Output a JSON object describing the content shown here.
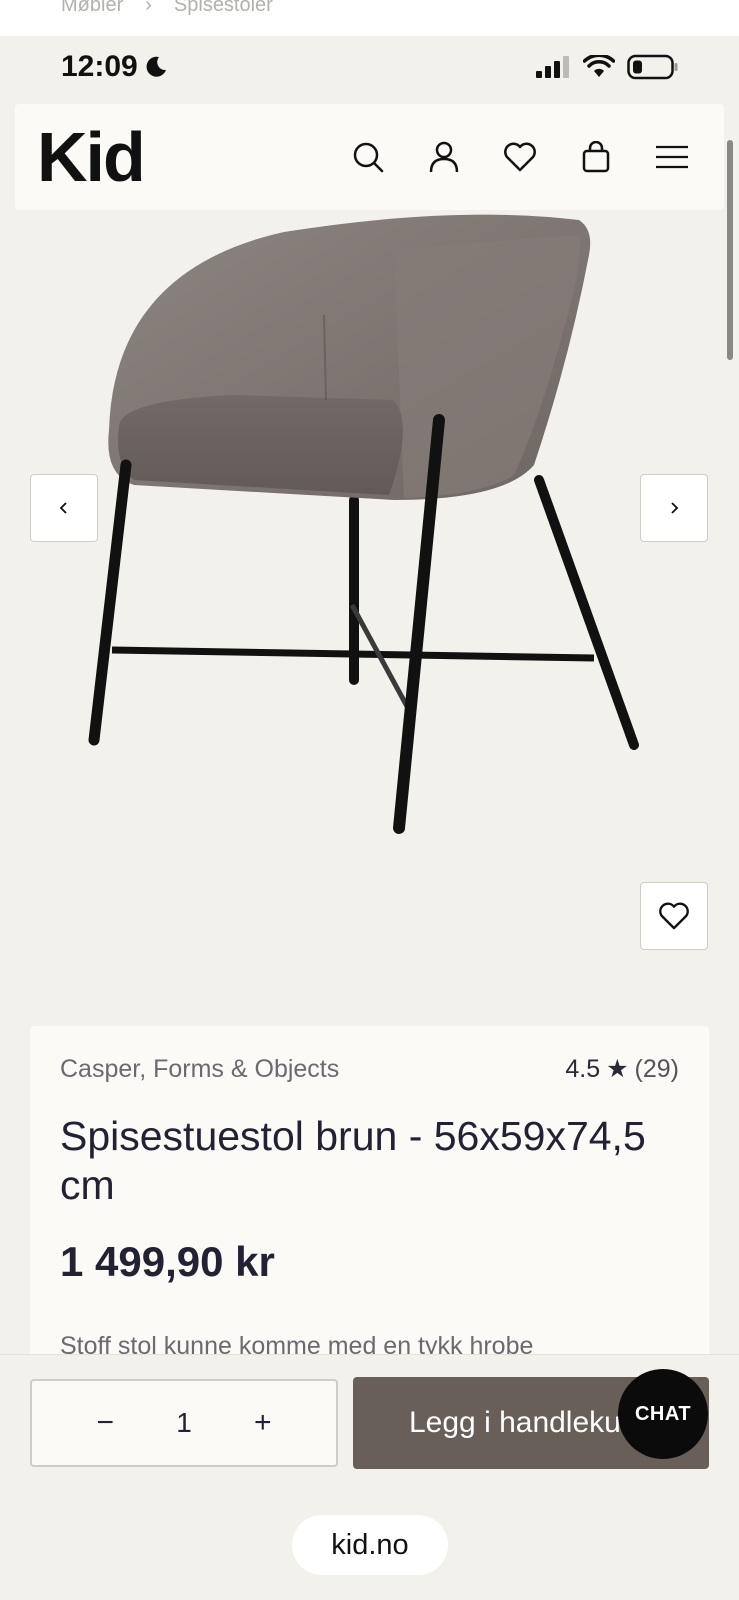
{
  "breadcrumb": {
    "items": [
      "Møbler",
      "›",
      "Spisestoler"
    ]
  },
  "status_bar": {
    "time": "12:09"
  },
  "header": {
    "logo": "Kid",
    "icons": [
      "search-icon",
      "account-icon",
      "heart-icon",
      "bag-icon",
      "menu-icon"
    ]
  },
  "gallery": {
    "prev_label": "‹",
    "next_label": "›"
  },
  "product": {
    "brand": "Casper, Forms & Objects",
    "rating": "4.5",
    "rating_star": "★",
    "reviews": "(29)",
    "title": "Spisestuestol brun - 56x59x74,5 cm",
    "price": "1 499,90 kr",
    "truncated_line": "Stoff stol kunne komme med en tykk hrobe"
  },
  "purchase": {
    "minus": "−",
    "quantity": "1",
    "plus": "+",
    "add_to_cart": "Legg i handlekurv",
    "chat": "CHAT"
  },
  "browser": {
    "url": "kid.no"
  },
  "colors": {
    "accent": "#675f58",
    "background": "#f3f1ec",
    "card": "#fbfaf7"
  }
}
